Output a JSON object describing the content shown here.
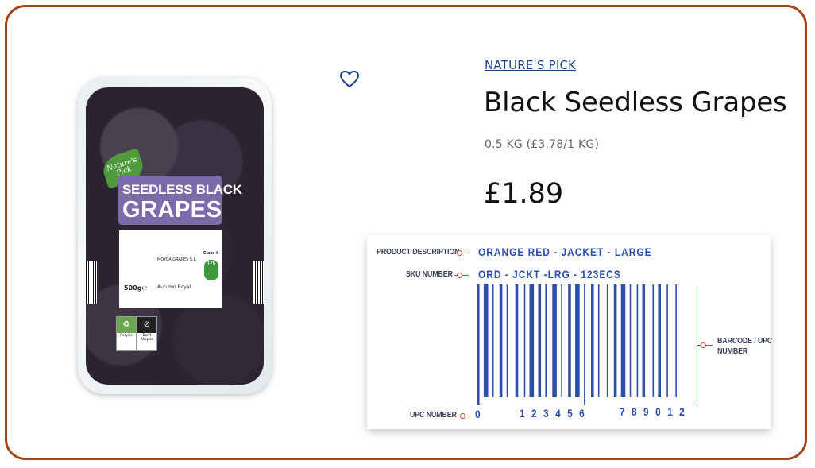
{
  "product_image": {
    "brand_logo": "Nature's Pick",
    "label_line1": "SEEDLESS BLACK",
    "label_line2": "GRAPES",
    "grower": "MOYCA GRAPES S.L.",
    "class": "Class I",
    "portion": "1/5",
    "weight": "500g℮",
    "variety": "Autumn Royal",
    "recycle_label": "Recycle",
    "film_label": "Don't Recycle"
  },
  "wishlist": {
    "icon": "heart-outline-icon"
  },
  "product": {
    "brand": "NATURE'S PICK",
    "title": "Black Seedless Grapes",
    "unit_price": "0.5 KG (£3.78/1 KG)",
    "price": "£1.89"
  },
  "barcode_diagram": {
    "product_description_label": "PRODUCT DESCRIPTION",
    "product_description_value": "ORANGE RED - JACKET - LARGE",
    "sku_label": "SKU NUMBER",
    "sku_value": "ORD - JCKT -LRG - 123ECS",
    "barcode_label_line1": "BARCODE / UPC",
    "barcode_label_line2": "NUMBER",
    "upc_label": "UPC NUMBER",
    "upc_digit_first": "0",
    "upc_group1": "1 2 3 4 5 6",
    "upc_group2": "7 8 9 0 1 2",
    "bar_color": "#2b4ea8",
    "connector_color": "#c44b3a"
  },
  "colors": {
    "frame_border": "#a0461a",
    "brand_link": "#1d3e8f"
  }
}
